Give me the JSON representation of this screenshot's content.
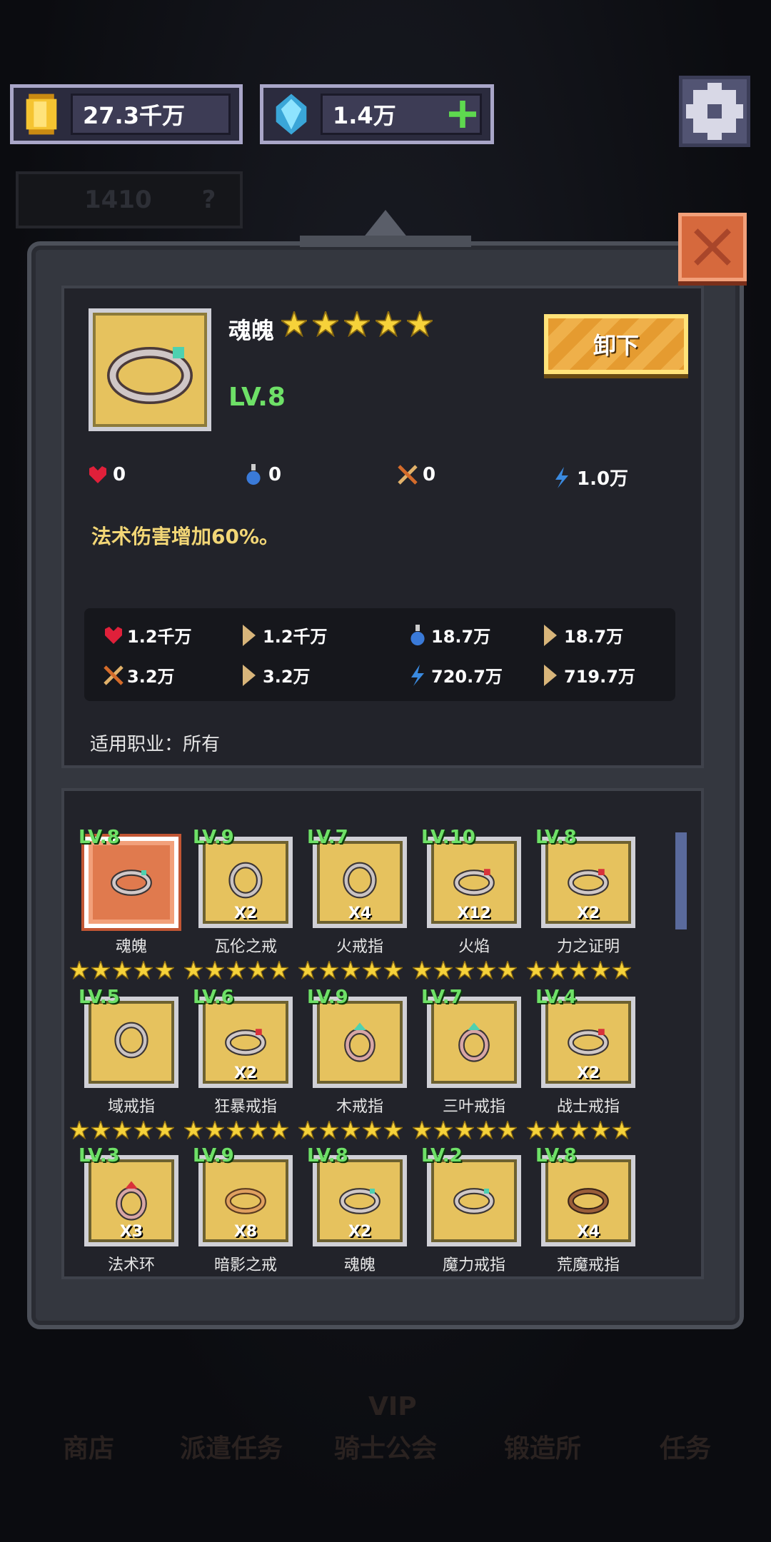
{
  "currency": {
    "gold": "27.3千万",
    "gems": "1.4万"
  },
  "faded_bar": {
    "value": "1410",
    "help": "?"
  },
  "item": {
    "name": "魂魄",
    "stars": 5,
    "level": "LV.8",
    "unequip_label": "卸下",
    "stats": {
      "hp": "0",
      "mp": "0",
      "atk": "0",
      "magic": "1.0万"
    },
    "effect": "法术伤害增加60%。",
    "totals": {
      "hp_current": "1.2千万",
      "hp_new": "1.2千万",
      "mp_current": "18.7万",
      "mp_new": "18.7万",
      "atk_current": "3.2万",
      "atk_new": "3.2万",
      "magic_current": "720.7万",
      "magic_new": "719.7万"
    },
    "job_label": "适用职业：所有"
  },
  "inventory": [
    {
      "lv": "LV.8",
      "name": "魂魄",
      "qty": "",
      "style": "oval-gem",
      "selected": true
    },
    {
      "lv": "LV.9",
      "name": "瓦伦之戒",
      "qty": "X2",
      "style": "round"
    },
    {
      "lv": "LV.7",
      "name": "火戒指",
      "qty": "X4",
      "style": "round"
    },
    {
      "lv": "LV.10",
      "name": "火焰",
      "qty": "X12",
      "style": "oval-red"
    },
    {
      "lv": "LV.8",
      "name": "力之证明",
      "qty": "X2",
      "style": "oval-red"
    },
    {
      "lv": "LV.5",
      "name": "域戒指",
      "qty": "",
      "style": "round"
    },
    {
      "lv": "LV.6",
      "name": "狂暴戒指",
      "qty": "X2",
      "style": "oval-red"
    },
    {
      "lv": "LV.9",
      "name": "木戒指",
      "qty": "",
      "style": "gem-teal"
    },
    {
      "lv": "LV.7",
      "name": "三叶戒指",
      "qty": "",
      "style": "gem-teal"
    },
    {
      "lv": "LV.4",
      "name": "战士戒指",
      "qty": "X2",
      "style": "oval-red"
    },
    {
      "lv": "LV.3",
      "name": "法术环",
      "qty": "X3",
      "style": "gem-red"
    },
    {
      "lv": "LV.9",
      "name": "暗影之戒",
      "qty": "X8",
      "style": "oval-brown"
    },
    {
      "lv": "LV.8",
      "name": "魂魄",
      "qty": "X2",
      "style": "oval-gem"
    },
    {
      "lv": "LV.2",
      "name": "魔力戒指",
      "qty": "",
      "style": "oval-gem"
    },
    {
      "lv": "LV.8",
      "name": "荒魔戒指",
      "qty": "X4",
      "style": "oval-dark"
    }
  ],
  "nav": [
    {
      "label": "商店"
    },
    {
      "label": "派遣任务"
    },
    {
      "label": "骑士公会"
    },
    {
      "label": "锻造所"
    },
    {
      "label": "任务"
    }
  ],
  "nav_vip": "VIP",
  "colors": {
    "level_green": "#6ee067",
    "gold_panel": "#e6c25e",
    "accent_orange": "#e9a63b"
  }
}
